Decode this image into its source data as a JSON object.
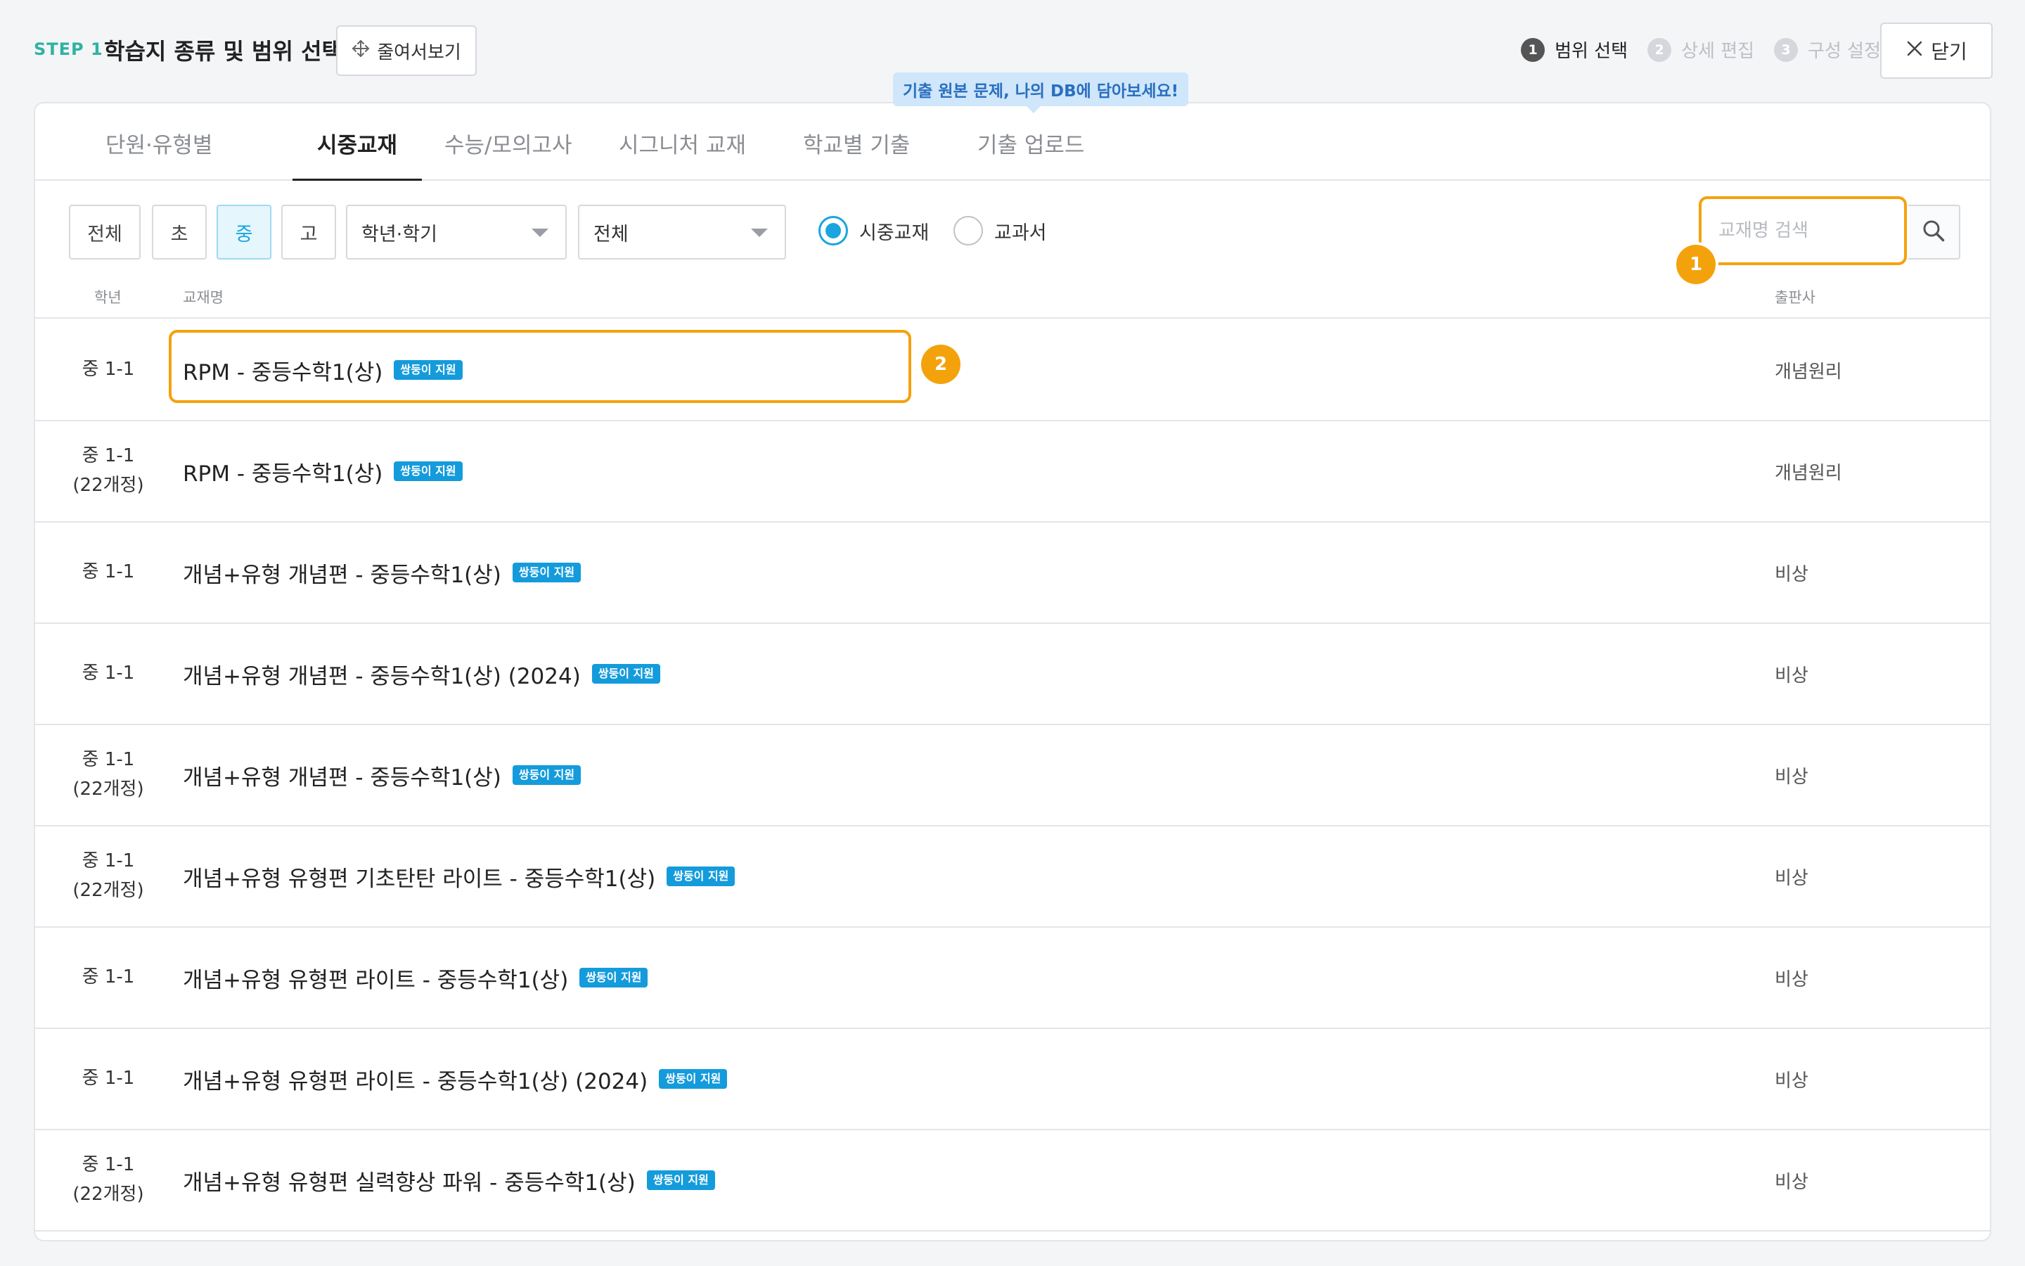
{
  "header": {
    "step": "STEP 1",
    "title": "학습지 종류 및 범위 선택",
    "preview_label": "줄여서보기",
    "steps": [
      {
        "num": "1",
        "label": "범위 선택"
      },
      {
        "num": "2",
        "label": "상세 편집"
      },
      {
        "num": "3",
        "label": "구성 설정"
      }
    ],
    "close_label": "닫기"
  },
  "tabs": [
    "단원·유형별",
    "시중교재",
    "수능/모의고사",
    "시그니처 교재",
    "학교별 기출",
    "기출 업로드"
  ],
  "tooltip": "기출 원본 문제, 나의 DB에 담아보세요!",
  "filters": {
    "levels": [
      "전체",
      "초",
      "중",
      "고"
    ],
    "grade_select": "학년·학기",
    "publisher_select": "전체",
    "radios": [
      "시중교재",
      "교과서"
    ],
    "search_placeholder": "교재명 검색"
  },
  "markers": [
    "1",
    "2"
  ],
  "table": {
    "headers": [
      "학년",
      "교재명",
      "출판사"
    ],
    "badge": "쌍둥이 지원",
    "rows": [
      {
        "grade": "중 1-1",
        "sub": "",
        "name": "RPM - 중등수학1(상)",
        "publisher": "개념원리"
      },
      {
        "grade": "중 1-1",
        "sub": "(22개정)",
        "name": "RPM - 중등수학1(상)",
        "publisher": "개념원리"
      },
      {
        "grade": "중 1-1",
        "sub": "",
        "name": "개념+유형 개념편 - 중등수학1(상)",
        "publisher": "비상"
      },
      {
        "grade": "중 1-1",
        "sub": "",
        "name": "개념+유형 개념편 - 중등수학1(상) (2024)",
        "publisher": "비상"
      },
      {
        "grade": "중 1-1",
        "sub": "(22개정)",
        "name": "개념+유형 개념편 - 중등수학1(상)",
        "publisher": "비상"
      },
      {
        "grade": "중 1-1",
        "sub": "(22개정)",
        "name": "개념+유형 유형편 기초탄탄 라이트 - 중등수학1(상)",
        "publisher": "비상"
      },
      {
        "grade": "중 1-1",
        "sub": "",
        "name": "개념+유형 유형편 라이트 - 중등수학1(상)",
        "publisher": "비상"
      },
      {
        "grade": "중 1-1",
        "sub": "",
        "name": "개념+유형 유형편 라이트 - 중등수학1(상) (2024)",
        "publisher": "비상"
      },
      {
        "grade": "중 1-1",
        "sub": "(22개정)",
        "name": "개념+유형 유형편 실력향상 파워 - 중등수학1(상)",
        "publisher": "비상"
      }
    ]
  }
}
